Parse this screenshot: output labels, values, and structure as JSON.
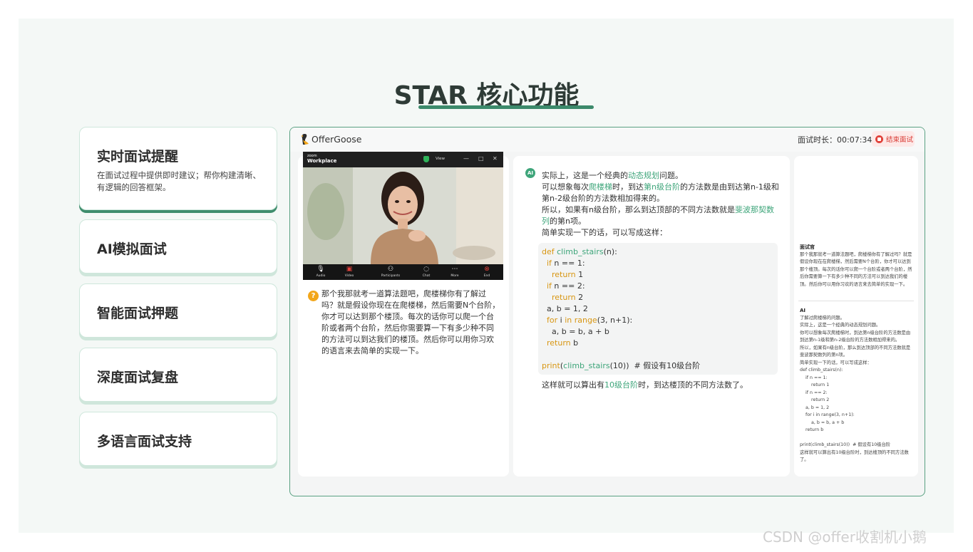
{
  "page": {
    "title": "STAR 核心功能"
  },
  "features": [
    {
      "title": "实时面试提醒",
      "desc": "在面试过程中提供即时建议；帮你构建清晰、有逻辑的回答框架。"
    },
    {
      "title": "AI模拟面试"
    },
    {
      "title": "智能面试押题"
    },
    {
      "title": "深度面试复盘"
    },
    {
      "title": "多语言面试支持"
    }
  ],
  "app": {
    "name": "OfferGoose",
    "timer": "面试时长：00:07:34",
    "end_button": "结束面试",
    "zoom": {
      "brand_small": "zoom",
      "brand": "Workplace",
      "view": "View",
      "toolbar": [
        "Audio",
        "Video",
        "Participants",
        "Chat",
        "More",
        "End"
      ]
    },
    "question": "那个我那就考一道算法题吧，爬楼梯你有了解过吗？就是假设你现在在爬楼梯，然后需要N个台阶，你才可以达到那个楼顶。每次的话你可以爬一个台阶或者两个台阶，然后你需要算一下有多少种不同的方法可以到达我们的楼顶。然后你可以用你习欢的语言来去简单的实现一下。",
    "answer": {
      "icon": "AI",
      "p1_a": "实际上，这是一个经典的",
      "p1_hl": "动态规划",
      "p1_b": "问题。",
      "p2_a": "可以想象每次",
      "p2_hl1": "爬楼梯",
      "p2_b": "时，到达",
      "p2_hl2": "第n级台阶",
      "p2_c": "的方法数是由到达第n-1级和第n-2级台阶的方法数相加得来的。",
      "p3_a": "所以，如果有n级台阶，那么到达顶部的不同方法数就是",
      "p3_hl": "斐波那契数列",
      "p3_b": "的第n项。",
      "p4": "简单实现一下的话，可以写成这样：",
      "code": {
        "l1_kw": "def",
        "l1_fn": "climb_stairs",
        "l1_rest": "(n):",
        "l2_kw": "if",
        "l2_rest": " n == 1:",
        "l3_kw": "return",
        "l3_rest": " 1",
        "l4_kw": "if",
        "l4_rest": " n == 2:",
        "l5_kw": "return",
        "l5_rest": " 2",
        "l6": "a, b = 1, 2",
        "l7_kw1": "for",
        "l7_mid1": " i ",
        "l7_kw2": "in",
        "l7_mid2": " ",
        "l7_fn": "range",
        "l7_rest": "(3, n+1):",
        "l8": "a, b = b, a + b",
        "l9_kw": "return",
        "l9_rest": " b",
        "l10_kw": "print",
        "l10_p1": "(",
        "l10_fn": "climb_stairs",
        "l10_rest": "(10))  # 假设有10级台阶"
      },
      "end_a": "这样就可以算出有",
      "end_hl": "10级台阶",
      "end_b": "时，到达楼顶的不同方法数了。"
    },
    "transcript": {
      "interviewer_label": "面试官",
      "interviewer_text": "那个我那就考一道算法题吧，爬楼梯你有了解过吗？就是假设你现在在爬楼梯，然后需要N个台阶，你才可以达到那个楼顶。每次的话你可以爬一个台阶或者两个台阶，然后你需要算一下有多少种不同的方法可以到达我们的楼顶。然后你可以用你习欢的语言来去简单的实现一下。",
      "ai_label": "AI",
      "ai_lines": [
        "了解过爬楼梯的问题。",
        "实际上，这是一个经典的动态规划问题。",
        "你可以想象每次爬楼梯时，到达第n级台阶的方法数是由到达第n-1级和第n-2级台阶的方法数相加得来的。",
        "所以，如果有n级台阶，那么到达顶部的不同方法数就是斐波那契数列的第n项。",
        "简单实现一下的话，可以写成这样：",
        "def climb_stairs(n):",
        "    if n == 1:",
        "        return 1",
        "    if n == 2:",
        "        return 2",
        "    a, b = 1, 2",
        "    for i in range(3, n+1):",
        "        a, b = b, a + b",
        "    return b",
        "",
        "print(climb_stairs(10))  # 假设有10级台阶",
        "这样就可以算出有10级台阶时，到达楼顶的不同方法数了。"
      ]
    }
  },
  "watermark": "CSDN @offer收割机小鹅",
  "colors": {
    "accent": "#3ea57a",
    "border": "#5aa182",
    "end": "#e0413a",
    "question_icon": "#f2a61a"
  }
}
